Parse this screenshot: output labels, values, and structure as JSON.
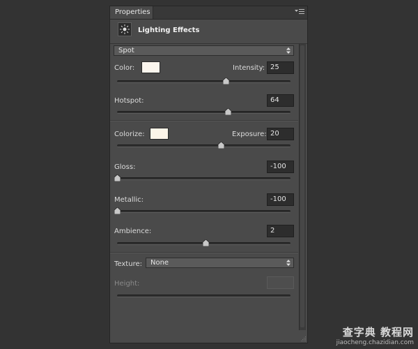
{
  "panel": {
    "tab_label": "Properties",
    "menu_icon": "panel-menu-icon",
    "header_icon": "lighting-effects-icon",
    "header_title": "Lighting Effects"
  },
  "light_type": {
    "selected": "Spot"
  },
  "controls": {
    "color": {
      "label": "Color:",
      "swatch": "#fbf6ee"
    },
    "intensity": {
      "label": "Intensity:",
      "value": "25",
      "level": 25,
      "min": -100,
      "max": 100
    },
    "hotspot": {
      "label": "Hotspot:",
      "value": "64",
      "level": 64,
      "min": 0,
      "max": 100
    },
    "colorize": {
      "label": "Colorize:",
      "swatch": "#fcf4e8"
    },
    "exposure": {
      "label": "Exposure:",
      "value": "20",
      "level": 20,
      "min": -100,
      "max": 100
    },
    "gloss": {
      "label": "Gloss:",
      "value": "-100",
      "level": -100,
      "min": -100,
      "max": 100
    },
    "metallic": {
      "label": "Metallic:",
      "value": "-100",
      "level": -100,
      "min": -100,
      "max": 100
    },
    "ambience": {
      "label": "Ambience:",
      "value": "2",
      "level": 2,
      "min": -100,
      "max": 100
    },
    "texture": {
      "label": "Texture:",
      "selected": "None"
    },
    "height": {
      "label": "Height:",
      "value": "",
      "level": 0,
      "min": 0,
      "max": 100
    }
  },
  "watermark": {
    "line1": "查字典 教程网",
    "line2": "jiaocheng.chazidian.com"
  },
  "colors": {
    "panel_bg": "#4a4a4a",
    "page_bg": "#333333"
  }
}
